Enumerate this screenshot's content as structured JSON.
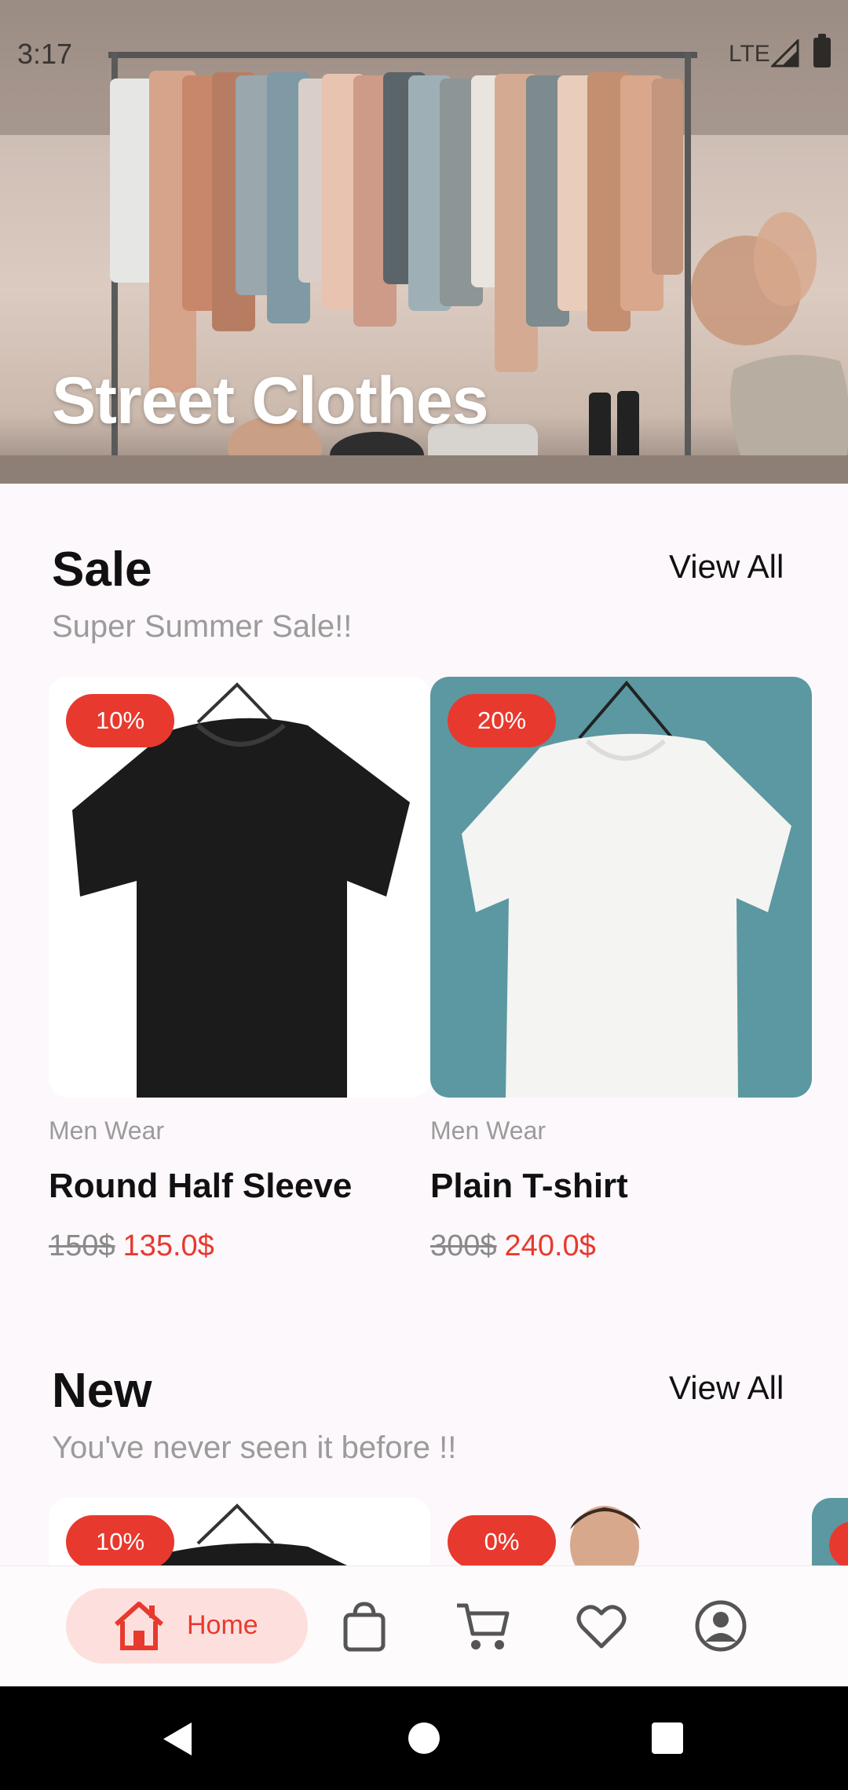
{
  "status": {
    "time": "3:17",
    "network": "LTE"
  },
  "hero": {
    "title": "Street Clothes"
  },
  "sale": {
    "title": "Sale",
    "subtitle": "Super Summer Sale!!",
    "view_all": "View All",
    "products": [
      {
        "badge": "10%",
        "category": "Men Wear",
        "name": "Round Half Sleeve",
        "old_price": "150$",
        "new_price": "135.0$",
        "image": "black-tshirt",
        "bg": "#ffffff"
      },
      {
        "badge": "20%",
        "category": "Men Wear",
        "name": "Plain T-shirt",
        "old_price": "300$",
        "new_price": "240.0$",
        "image": "white-tshirt",
        "bg": "#5b98a1"
      }
    ]
  },
  "new": {
    "title": "New",
    "subtitle": "You've never seen it before !!",
    "view_all": "View All",
    "products": [
      {
        "badge": "10%",
        "image": "black-tshirt"
      },
      {
        "badge": "0%",
        "image": "man-portrait"
      }
    ]
  },
  "bottom_nav": {
    "items": [
      {
        "label": "Home",
        "icon": "home-icon",
        "active": true
      },
      {
        "label": "",
        "icon": "bag-icon",
        "active": false
      },
      {
        "label": "",
        "icon": "cart-icon",
        "active": false
      },
      {
        "label": "",
        "icon": "heart-icon",
        "active": false
      },
      {
        "label": "",
        "icon": "profile-icon",
        "active": false
      }
    ]
  },
  "colors": {
    "accent": "#e8392e",
    "accent_soft": "#fde0dd",
    "background": "#fdf8fb",
    "teal": "#5b98a1"
  }
}
